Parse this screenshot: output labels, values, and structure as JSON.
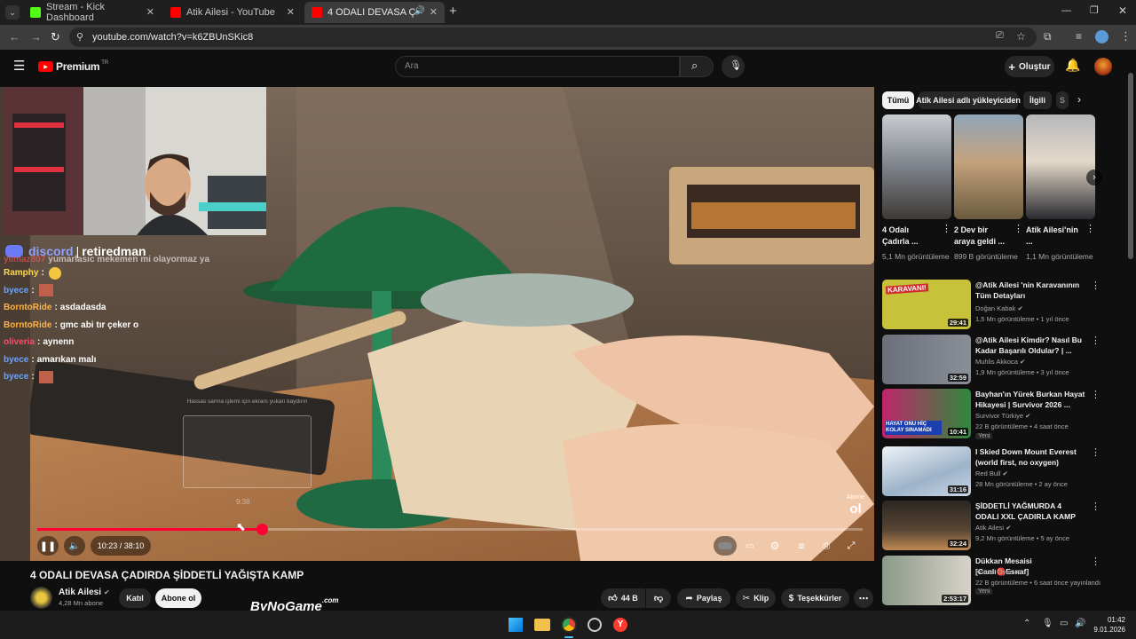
{
  "browser": {
    "tabs": [
      {
        "title": "Stream - Kick Dashboard",
        "favicon_color": "#53fc18"
      },
      {
        "title": "Atik Ailesi - YouTube",
        "favicon_color": "#ff0000"
      },
      {
        "title": "4 ODALI DEVASA ÇADIRDA",
        "favicon_color": "#ff0000"
      }
    ],
    "url": "youtube.com/watch?v=k6ZBUnSKic8"
  },
  "header": {
    "logo": "Premium",
    "region": "TR",
    "search_placeholder": "Ara",
    "create_label": "Oluştur"
  },
  "overlay": {
    "discord_label": "discord",
    "discord_user": "retiredman",
    "chat": [
      {
        "user": "yilmaz807",
        "msg": "yumarlasıc mekemen mi olayormaz ya",
        "color": "#ff5a5a"
      },
      {
        "user": "Ramphy",
        "msg": "",
        "color": "#ffd84a",
        "emote": true
      },
      {
        "user": "byece",
        "msg": "",
        "color": "#6aa3ff",
        "emote": true
      },
      {
        "user": "BorntoRide",
        "msg": "asdadasda",
        "color": "#ffb347"
      },
      {
        "user": "BorntoRide",
        "msg": "gmc abi tır çeker o",
        "color": "#ffb347"
      },
      {
        "user": "oliveria",
        "msg": "aynenn",
        "color": "#ff4d6d"
      },
      {
        "user": "byece",
        "msg": "amarıkan malı",
        "color": "#6aa3ff"
      },
      {
        "user": "byece",
        "msg": "",
        "color": "#6aa3ff",
        "emote": true
      }
    ],
    "hover_tip": "Hassas sarma işlemi için ekranı yukarı kaydırın",
    "hover_time": "9:38",
    "watermark_top": "Abone",
    "watermark_bottom": "ol"
  },
  "player": {
    "time": "10:23 / 38:10",
    "progress": 0.2725,
    "hover_progress": 0.25
  },
  "video": {
    "title": "4 ODALI DEVASA ÇADIRDA ŞİDDETLİ YAĞIŞTA KAMP",
    "channel": "Atik Ailesi",
    "subscribers": "4,28 Mn abone",
    "join_label": "Katıl",
    "subscribe_label": "Abone ol",
    "likes": "44 B",
    "share_label": "Paylaş",
    "clip_label": "Klip",
    "thanks_label": "Teşekkürler",
    "brand_watermark": "ByNoGame",
    "brand_suffix": ".com"
  },
  "sidebar": {
    "filters": [
      "Tümü",
      "Atik Ailesi adlı yükleyiciden",
      "İlgili",
      "S"
    ],
    "shorts": [
      {
        "title": "4 Odalı Çadırla ...",
        "views": "5,1 Mn görüntüleme"
      },
      {
        "title": "2 Dev bir araya geldi ...",
        "views": "899 B görüntüleme"
      },
      {
        "title": "Atik Ailesi'nin ...",
        "views": "1,1 Mn görüntüleme"
      }
    ],
    "recommended": [
      {
        "title": "@Atik Ailesi 'nin Karavanının Tüm Detayları",
        "channel": "Doğan Kabak",
        "meta": "1,5 Mn görüntüleme • 1 yıl önce",
        "duration": "29:41",
        "thumb_color": "#c8c13a",
        "thumb_text": "KARAVANI!"
      },
      {
        "title": "@Atik Ailesi Kimdir? Nasıl Bu Kadar Başarılı Oldular? | ...",
        "channel": "Muhlis Akkoca",
        "meta": "1,9 Mn görüntüleme • 3 yıl önce",
        "duration": "32:59",
        "thumb_color": "#6a6f7a",
        "thumb_text": ""
      },
      {
        "title": "Bayhan'ın Yürek Burkan Hayat Hikayesi | Survivor 2026 ...",
        "channel": "Survivor Türkiye",
        "meta": "22 B görüntüleme • 4 saat önce",
        "duration": "10:41",
        "thumb_color": "#2e8a3d",
        "thumb_text": "HAYAT ONU HİÇ KOLAY SINAMADI",
        "badge": "Yeni"
      },
      {
        "title": "I Skied Down Mount Everest (world first, no oxygen)",
        "channel": "Red Bull",
        "meta": "28 Mn görüntüleme • 2 ay önce",
        "duration": "31:16",
        "thumb_color": "#c9d7e6",
        "thumb_text": ""
      },
      {
        "title": "ŞİDDETLİ YAĞMURDA 4 ODALI XXL ÇADIRLA KAMP",
        "channel": "Atik Ailesi",
        "meta": "9,2 Mn görüntüleme • 5 ay önce",
        "duration": "32:24",
        "thumb_color": "#3a3026",
        "thumb_text": ""
      },
      {
        "title": "Dükkan Mesaisi [Canlı🔴Esnaf]",
        "channel": "Konsol Oyun",
        "meta": "22 B görüntüleme • 6 saat önce yayınlandı",
        "duration": "2:53:17",
        "thumb_color": "#6b7d6a",
        "thumb_text": "",
        "badge": "Yeni"
      }
    ]
  },
  "taskbar": {
    "time": "01:42",
    "date": "9.01.2026"
  }
}
